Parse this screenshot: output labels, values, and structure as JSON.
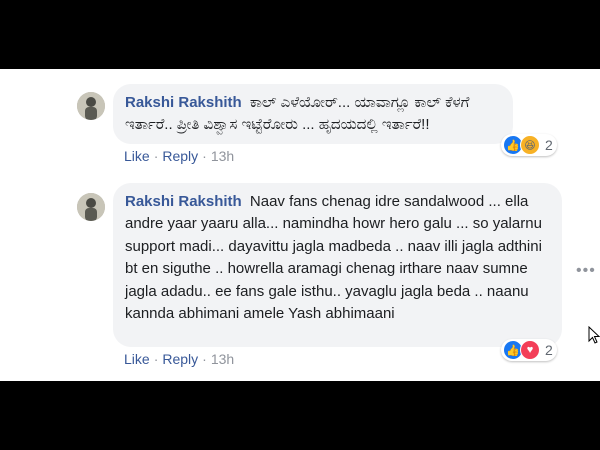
{
  "comments": [
    {
      "author": "Rakshi Rakshith",
      "text": "ಕಾಲ್ ಎಳೆಯೋರ್... ಯಾವಾಗ್ಲೂ ಕಾಲ್ ಕೆಳಗೆ ಇರ್ತಾರೆ.. ಪ್ರೀತಿ ವಿಶ್ವಾಸ ಇಟ್ಟೆರೋರು ... ಹೃದಯದಲ್ಲಿ ಇರ್ತಾರೆ!!",
      "like_label": "Like",
      "reply_label": "Reply",
      "time": "13h",
      "reaction_count": "2",
      "reactions": [
        "like-icon",
        "haha-icon"
      ]
    },
    {
      "author": "Rakshi Rakshith",
      "text": "Naav fans chenag idre sandalwood ... ella andre yaar yaaru alla... namindha howr hero galu ... so yalarnu support madi... dayavittu jagla madbeda .. naav illi jagla adthini bt en siguthe .. howrella aramagi chenag irthare naav sumne jagla adadu.. ee fans gale isthu.. yavaglu jagla beda .. naanu kannda abhimani amele Yash abhimaani",
      "like_label": "Like",
      "reply_label": "Reply",
      "time": "13h",
      "reaction_count": "2",
      "reactions": [
        "like-icon",
        "love-icon"
      ]
    }
  ],
  "more_options": "•••",
  "colors": {
    "link": "#385898",
    "bubble": "#f2f3f5",
    "meta": "#90949c"
  }
}
